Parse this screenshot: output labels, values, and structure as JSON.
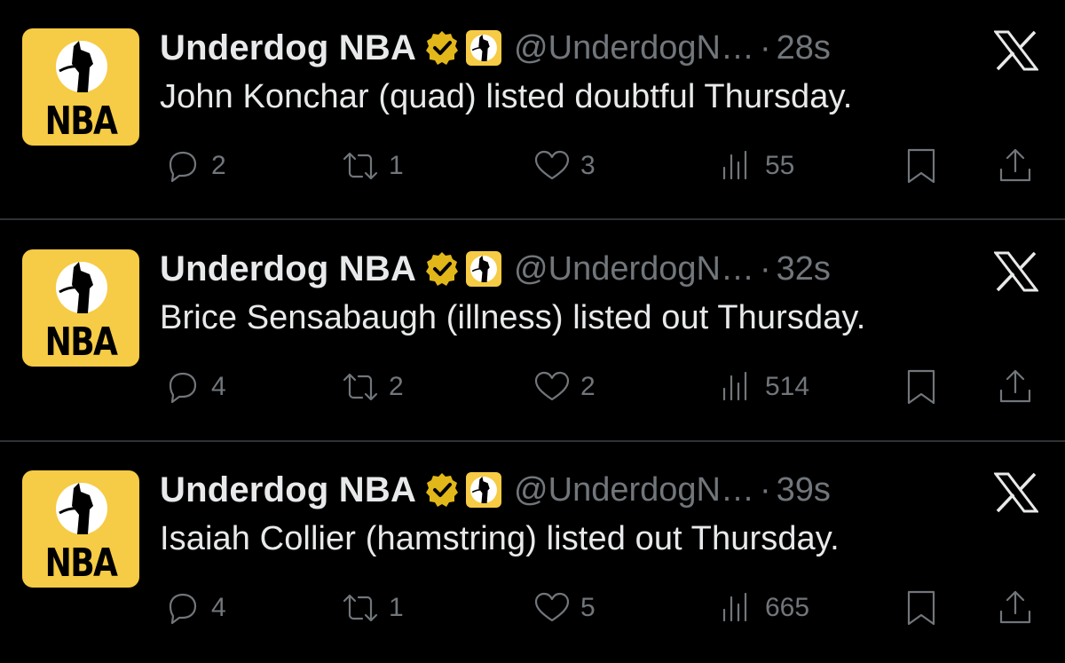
{
  "account": {
    "name": "Underdog NBA",
    "handle": "@UnderdogN…",
    "separator": "·",
    "avatar_text": "NBA",
    "brand_color": "#f6cb45"
  },
  "icons": {
    "verified": "verified-badge-icon",
    "affiliate": "underdog-dog-icon",
    "platform": "x-logo-icon",
    "reply": "reply-icon",
    "retweet": "retweet-icon",
    "like": "heart-icon",
    "views": "views-icon",
    "bookmark": "bookmark-icon",
    "share": "share-icon"
  },
  "tweets": [
    {
      "time": "28s",
      "text": "John Konchar (quad) listed doubtful Thursday.",
      "replies": "2",
      "retweets": "1",
      "likes": "3",
      "views": "55"
    },
    {
      "time": "32s",
      "text": "Brice Sensabaugh (illness) listed out Thursday.",
      "replies": "4",
      "retweets": "2",
      "likes": "2",
      "views": "514"
    },
    {
      "time": "39s",
      "text": "Isaiah Collier (hamstring) listed out Thursday.",
      "replies": "4",
      "retweets": "1",
      "likes": "5",
      "views": "665"
    }
  ]
}
